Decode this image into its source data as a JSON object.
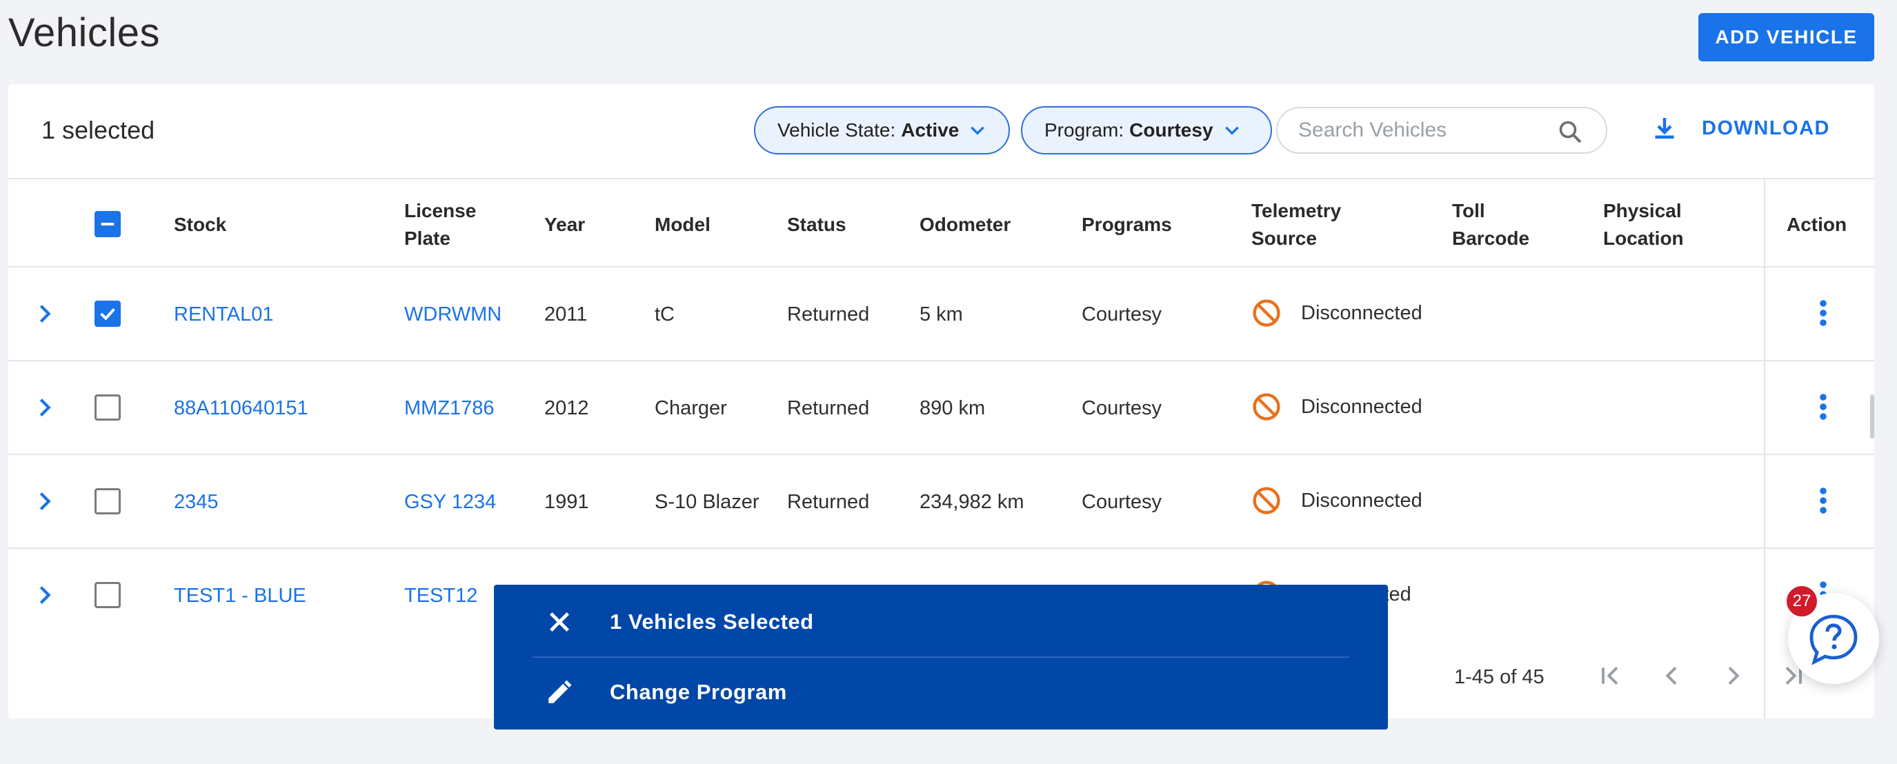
{
  "page": {
    "title": "Vehicles",
    "add_button": "ADD VEHICLE"
  },
  "toolbar": {
    "selected_text": "1 selected",
    "filters": [
      {
        "label": "Vehicle State:",
        "value": "Active"
      },
      {
        "label": "Program:",
        "value": "Courtesy"
      }
    ],
    "search_placeholder": "Search Vehicles",
    "download_label": "DOWNLOAD"
  },
  "table": {
    "headers": {
      "stock": "Stock",
      "license_1": "License",
      "license_2": "Plate",
      "year": "Year",
      "model": "Model",
      "status": "Status",
      "odometer": "Odometer",
      "programs": "Programs",
      "telemetry_1": "Telemetry",
      "telemetry_2": "Source",
      "toll_1": "Toll",
      "toll_2": "Barcode",
      "physical_1": "Physical",
      "physical_2": "Location",
      "action": "Action"
    },
    "rows": [
      {
        "checked": true,
        "stock": "RENTAL01",
        "plate": "WDRWMN",
        "year": "2011",
        "model": "tC",
        "status": "Returned",
        "odometer": "5 km",
        "program": "Courtesy",
        "telemetry": "Disconnected"
      },
      {
        "checked": false,
        "stock": "88A110640151",
        "plate": "MMZ1786",
        "year": "2012",
        "model": "Charger",
        "status": "Returned",
        "odometer": "890 km",
        "program": "Courtesy",
        "telemetry": "Disconnected"
      },
      {
        "checked": false,
        "stock": "2345",
        "plate": "GSY 1234",
        "year": "1991",
        "model": "S-10 Blazer",
        "status": "Returned",
        "odometer": "234,982 km",
        "program": "Courtesy",
        "telemetry": "Disconnected"
      },
      {
        "checked": false,
        "stock": "TEST1 - BLUE",
        "plate": "TEST12",
        "year": "",
        "model": "",
        "status": "",
        "odometer": "",
        "program": "",
        "telemetry": "cted"
      }
    ]
  },
  "pagination": {
    "range": "1-45 of 45"
  },
  "selection_bar": {
    "title": "1 Vehicles Selected",
    "action": "Change Program"
  },
  "help": {
    "badge_count": "27"
  },
  "colors": {
    "accent": "#1a73e8",
    "selection_bar": "#0047a8",
    "disconnected": "#e8711c",
    "badge": "#d11a2a"
  },
  "icons": [
    "search-icon",
    "chevron-down-icon",
    "download-icon",
    "chevron-right-icon",
    "checkbox-icon",
    "block-icon",
    "more-vert-icon",
    "close-icon",
    "pencil-icon",
    "first-page-icon",
    "prev-page-icon",
    "next-page-icon",
    "last-page-icon",
    "help-chat-icon"
  ]
}
